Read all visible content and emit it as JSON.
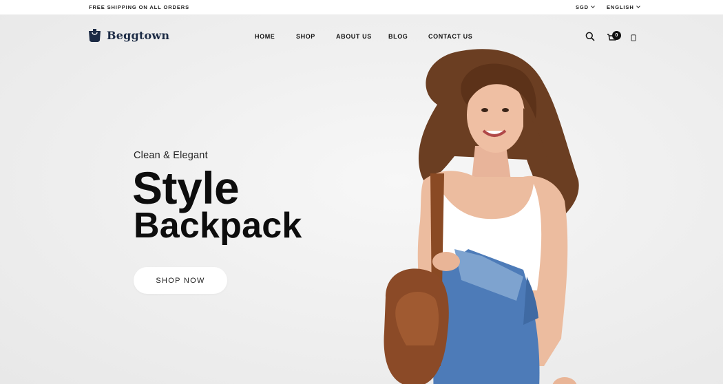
{
  "topbar": {
    "shipping_text": "FREE SHIPPING ON ALL ORDERS",
    "currency": "SGD",
    "language": "ENGLISH"
  },
  "header": {
    "logo_text": "Beggtown",
    "nav": [
      "HOME",
      "SHOP",
      "ABOUT US",
      "BLOG",
      "CONTACT US"
    ],
    "cart_count": "0",
    "icons": [
      "search-icon",
      "cart-icon",
      "mobile-phone-icon"
    ]
  },
  "hero": {
    "caption": "Clean & Elegant",
    "title_line1": "Style",
    "title_line2": "Backpack",
    "button_label": "SHOP NOW"
  },
  "colors": {
    "logo": "#1c2b45",
    "text": "#0d0d0d",
    "background": "#efefef",
    "badge": "#111111"
  }
}
